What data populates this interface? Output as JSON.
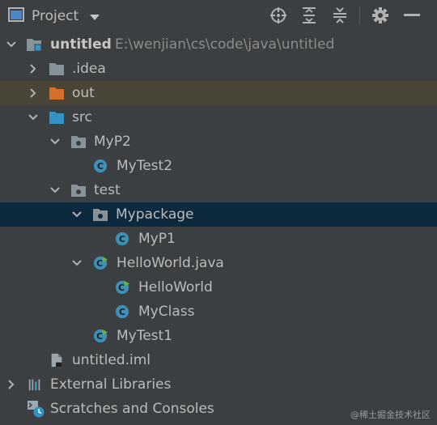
{
  "header": {
    "title": "Project",
    "icons": [
      "project-window-icon",
      "chevron-down-icon",
      "locate-icon",
      "expand-all-icon",
      "collapse-all-icon",
      "gear-icon",
      "hide-icon"
    ]
  },
  "tree": {
    "root": {
      "label": "untitled",
      "path": "E:\\wenjian\\cs\\code\\java\\untitled"
    },
    "idea": {
      "label": ".idea"
    },
    "out": {
      "label": "out"
    },
    "src": {
      "label": "src"
    },
    "myp2": {
      "label": "MyP2"
    },
    "mytest2": {
      "label": "MyTest2"
    },
    "test": {
      "label": "test"
    },
    "mypackage": {
      "label": "Mypackage"
    },
    "myp1": {
      "label": "MyP1"
    },
    "helloworld_java": {
      "label": "HelloWorld.java"
    },
    "helloworld": {
      "label": "HelloWorld"
    },
    "myclass": {
      "label": "MyClass"
    },
    "mytest1": {
      "label": "MyTest1"
    },
    "iml": {
      "label": "untitled.iml"
    },
    "extlibs": {
      "label": "External Libraries"
    },
    "scratches": {
      "label": "Scratches and Consoles"
    }
  },
  "colors": {
    "background": "#3c3f41",
    "selection": "#0d293e",
    "excluded": "#4a4637",
    "folder": "#87939a",
    "source_folder": "#3592c4",
    "excluded_folder": "#d86e2b",
    "class_icon": "#3d8fb5",
    "run_marker": "#62b543"
  },
  "watermark": "@稀土掘金技术社区"
}
